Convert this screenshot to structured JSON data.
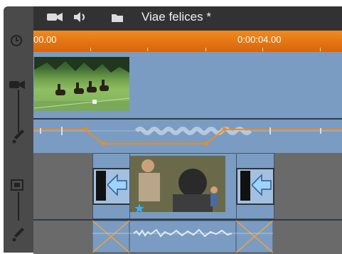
{
  "window": {
    "title": "Viae felices *"
  },
  "toolbar": {
    "icons": [
      "camera-icon",
      "speaker-icon",
      "folder-icon"
    ]
  },
  "ruler": {
    "timecode_left": "00.00",
    "timecode_right": "0:00:04.00"
  },
  "tracks": [
    {
      "kind": "video",
      "icon": "camera-icon"
    },
    {
      "kind": "audio",
      "icon": "edit-audio-icon"
    },
    {
      "kind": "video",
      "icon": "frame-icon"
    },
    {
      "kind": "audio",
      "icon": "edit-audio-icon"
    }
  ],
  "colors": {
    "ruler_orange": "#e8761a",
    "track_blue": "#7a9cc2",
    "audio_line": "#f08a1e",
    "titlebar": "#323232",
    "transition_arrow": "#7fb2e8",
    "star": "#3ab0ff"
  }
}
